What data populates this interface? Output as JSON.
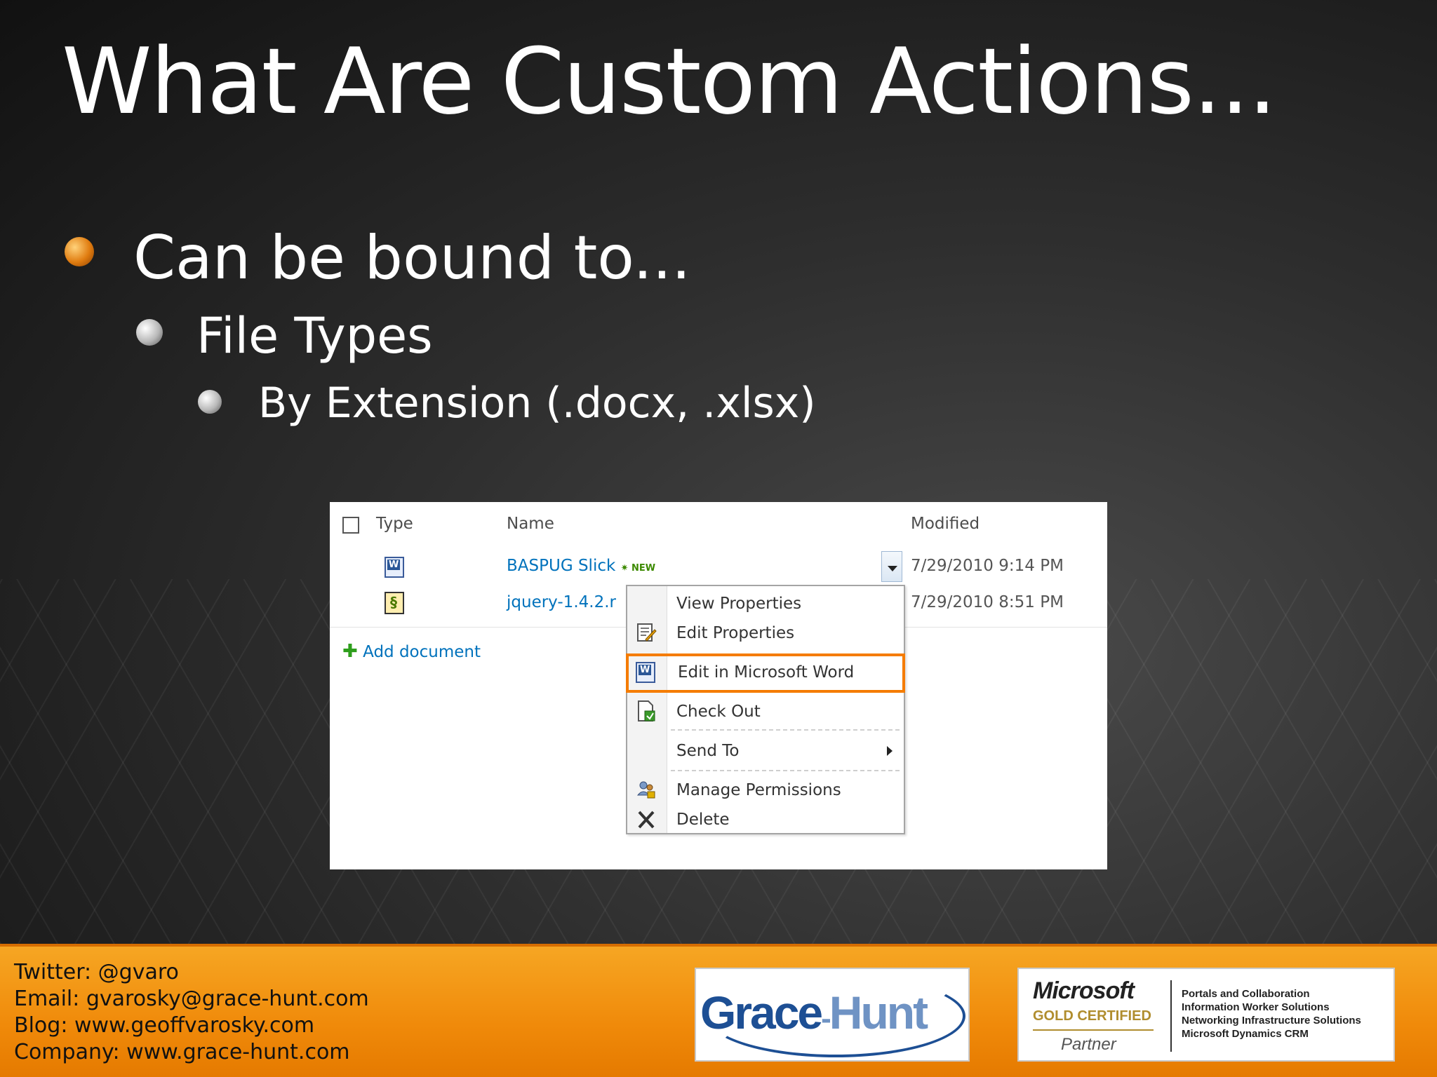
{
  "slide": {
    "title": "What Are Custom Actions...",
    "bullets": [
      {
        "text": "Can be bound to...",
        "level": 1
      },
      {
        "text": "File Types",
        "level": 2
      },
      {
        "text": "By Extension (.docx, .xlsx)",
        "level": 3
      }
    ]
  },
  "doc_library": {
    "columns": {
      "type": "Type",
      "name": "Name",
      "modified": "Modified"
    },
    "rows": [
      {
        "name": "BASPUG Slick",
        "badge": "NEW",
        "modified": "7/29/2010 9:14 PM",
        "icon": "word-doc-icon"
      },
      {
        "name": "jquery-1.4.2.r",
        "badge": "",
        "modified": "7/29/2010 8:51 PM",
        "icon": "script-file-icon"
      }
    ],
    "add_document": "Add document",
    "context_menu": [
      {
        "label": "View Properties",
        "icon": ""
      },
      {
        "label": "Edit Properties",
        "icon": "edit-properties-icon"
      },
      {
        "label": "Edit in Microsoft Word",
        "icon": "word-doc-icon",
        "highlighted": true
      },
      {
        "label": "Check Out",
        "icon": "check-out-icon"
      },
      {
        "label": "Send To",
        "icon": "",
        "submenu": true
      },
      {
        "label": "Manage Permissions",
        "icon": "permissions-icon"
      },
      {
        "label": "Delete",
        "icon": "delete-icon"
      }
    ]
  },
  "footer": {
    "contact": [
      "Twitter: @gvaro",
      "Email: gvarosky@grace-hunt.com",
      "Blog: www.geoffvarosky.com",
      "Company: www.grace-hunt.com"
    ],
    "logo_grace_hunt": {
      "part1": "Grace",
      "sep": "-",
      "part2": "Hunt"
    },
    "logo_microsoft": {
      "name": "Microsoft",
      "certification": "GOLD CERTIFIED",
      "partner": "Partner",
      "competencies": [
        "Portals and Collaboration",
        "Information Worker Solutions",
        "Networking Infrastructure Solutions",
        "Microsoft Dynamics CRM"
      ]
    }
  },
  "colors": {
    "accent": "#f57c00",
    "link": "#0072bc"
  }
}
